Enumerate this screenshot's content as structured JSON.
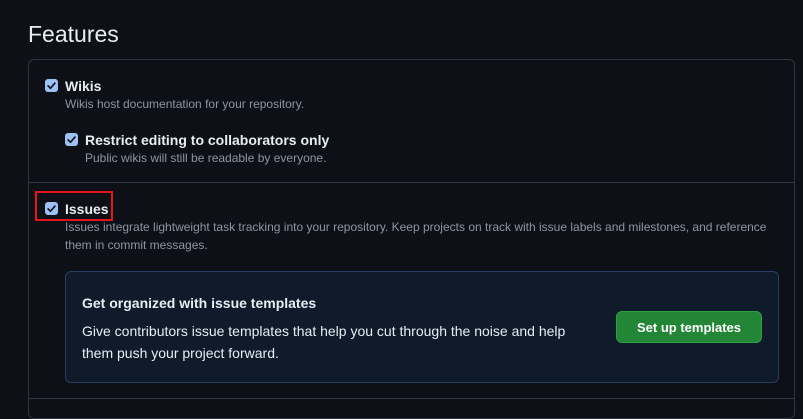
{
  "page": {
    "title": "Features"
  },
  "wikis": {
    "label": "Wikis",
    "checked": true,
    "description": "Wikis host documentation for your repository.",
    "restrict": {
      "label": "Restrict editing to collaborators only",
      "checked": true,
      "description": "Public wikis will still be readable by everyone."
    }
  },
  "issues": {
    "label": "Issues",
    "checked": true,
    "description": "Issues integrate lightweight task tracking into your repository. Keep projects on track with issue labels and milestones, and reference them in commit messages."
  },
  "templates": {
    "title": "Get organized with issue templates",
    "description": "Give contributors issue templates that help you cut through the noise and help them push your project forward.",
    "button_label": "Set up templates"
  },
  "colors": {
    "background": "#0d1117",
    "border": "#30363d",
    "checkbox": "#9ec1f5",
    "highlight": "#e5151b",
    "button": "#238636",
    "callout_bg": "#0f1a2b"
  }
}
